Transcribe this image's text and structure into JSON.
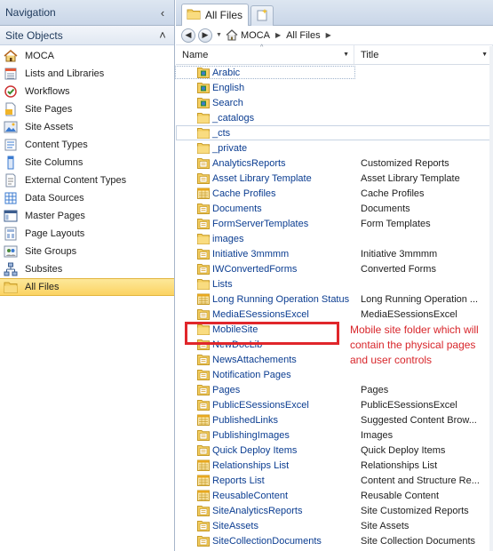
{
  "nav": {
    "title": "Navigation",
    "collapse_glyph": "‹",
    "group_title": "Site Objects",
    "group_glyph": "˄",
    "items": [
      {
        "label": "MOCA",
        "icon": "site-home-icon"
      },
      {
        "label": "Lists and Libraries",
        "icon": "list-icon"
      },
      {
        "label": "Workflows",
        "icon": "workflow-icon"
      },
      {
        "label": "Site Pages",
        "icon": "page-icon"
      },
      {
        "label": "Site Assets",
        "icon": "asset-icon"
      },
      {
        "label": "Content Types",
        "icon": "content-type-icon"
      },
      {
        "label": "Site Columns",
        "icon": "column-icon"
      },
      {
        "label": "External Content Types",
        "icon": "external-content-icon"
      },
      {
        "label": "Data Sources",
        "icon": "data-source-icon"
      },
      {
        "label": "Master Pages",
        "icon": "master-page-icon"
      },
      {
        "label": "Page Layouts",
        "icon": "page-layout-icon"
      },
      {
        "label": "Site Groups",
        "icon": "group-icon"
      },
      {
        "label": "Subsites",
        "icon": "subsite-icon"
      },
      {
        "label": "All Files",
        "icon": "folder-icon",
        "selected": true
      }
    ]
  },
  "tabs": {
    "active_label": "All Files",
    "new_tab_icon": "new-tab-icon"
  },
  "toolbar": {
    "breadcrumb": [
      "MOCA",
      "All Files"
    ]
  },
  "columns": {
    "name": "Name",
    "title": "Title"
  },
  "files": [
    {
      "name": "Arabic",
      "title": "",
      "icon": "site-folder"
    },
    {
      "name": "English",
      "title": "",
      "icon": "site-folder"
    },
    {
      "name": "Search",
      "title": "",
      "icon": "site-folder"
    },
    {
      "name": "_catalogs",
      "title": "",
      "icon": "folder"
    },
    {
      "name": "_cts",
      "title": "",
      "icon": "folder"
    },
    {
      "name": "_private",
      "title": "",
      "icon": "folder"
    },
    {
      "name": "AnalyticsReports",
      "title": "Customized Reports",
      "icon": "library"
    },
    {
      "name": "Asset Library Template",
      "title": "Asset Library Template",
      "icon": "library"
    },
    {
      "name": "Cache Profiles",
      "title": "Cache Profiles",
      "icon": "list"
    },
    {
      "name": "Documents",
      "title": "Documents",
      "icon": "library"
    },
    {
      "name": "FormServerTemplates",
      "title": "Form Templates",
      "icon": "library"
    },
    {
      "name": "images",
      "title": "",
      "icon": "folder"
    },
    {
      "name": "Initiative 3mmmm",
      "title": "Initiative 3mmmm",
      "icon": "library"
    },
    {
      "name": "IWConvertedForms",
      "title": "Converted Forms",
      "icon": "library"
    },
    {
      "name": "Lists",
      "title": "",
      "icon": "folder"
    },
    {
      "name": "Long Running Operation Status",
      "title": "Long Running Operation ...",
      "icon": "list"
    },
    {
      "name": "MediaESessionsExcel",
      "title": "MediaESessionsExcel",
      "icon": "library"
    },
    {
      "name": "MobileSite",
      "title": "",
      "icon": "folder"
    },
    {
      "name": "NewDocLib",
      "title": "",
      "icon": "library"
    },
    {
      "name": "NewsAttachements",
      "title": "",
      "icon": "library"
    },
    {
      "name": "Notification Pages",
      "title": "",
      "icon": "library"
    },
    {
      "name": "Pages",
      "title": "Pages",
      "icon": "library"
    },
    {
      "name": "PublicESessionsExcel",
      "title": "PublicESessionsExcel",
      "icon": "library"
    },
    {
      "name": "PublishedLinks",
      "title": "Suggested Content Brow...",
      "icon": "list"
    },
    {
      "name": "PublishingImages",
      "title": "Images",
      "icon": "library"
    },
    {
      "name": "Quick Deploy Items",
      "title": "Quick Deploy Items",
      "icon": "library"
    },
    {
      "name": "Relationships List",
      "title": "Relationships List",
      "icon": "list"
    },
    {
      "name": "Reports List",
      "title": "Content and Structure Re...",
      "icon": "list"
    },
    {
      "name": "ReusableContent",
      "title": "Reusable Content",
      "icon": "list"
    },
    {
      "name": "SiteAnalyticsReports",
      "title": "Site Customized Reports",
      "icon": "library"
    },
    {
      "name": "SiteAssets",
      "title": "Site Assets",
      "icon": "library"
    },
    {
      "name": "SiteCollectionDocuments",
      "title": "Site Collection Documents",
      "icon": "library"
    }
  ],
  "annotation": {
    "text": "Mobile site folder which will contain the physical pages and user controls",
    "color": "#d8262b"
  }
}
